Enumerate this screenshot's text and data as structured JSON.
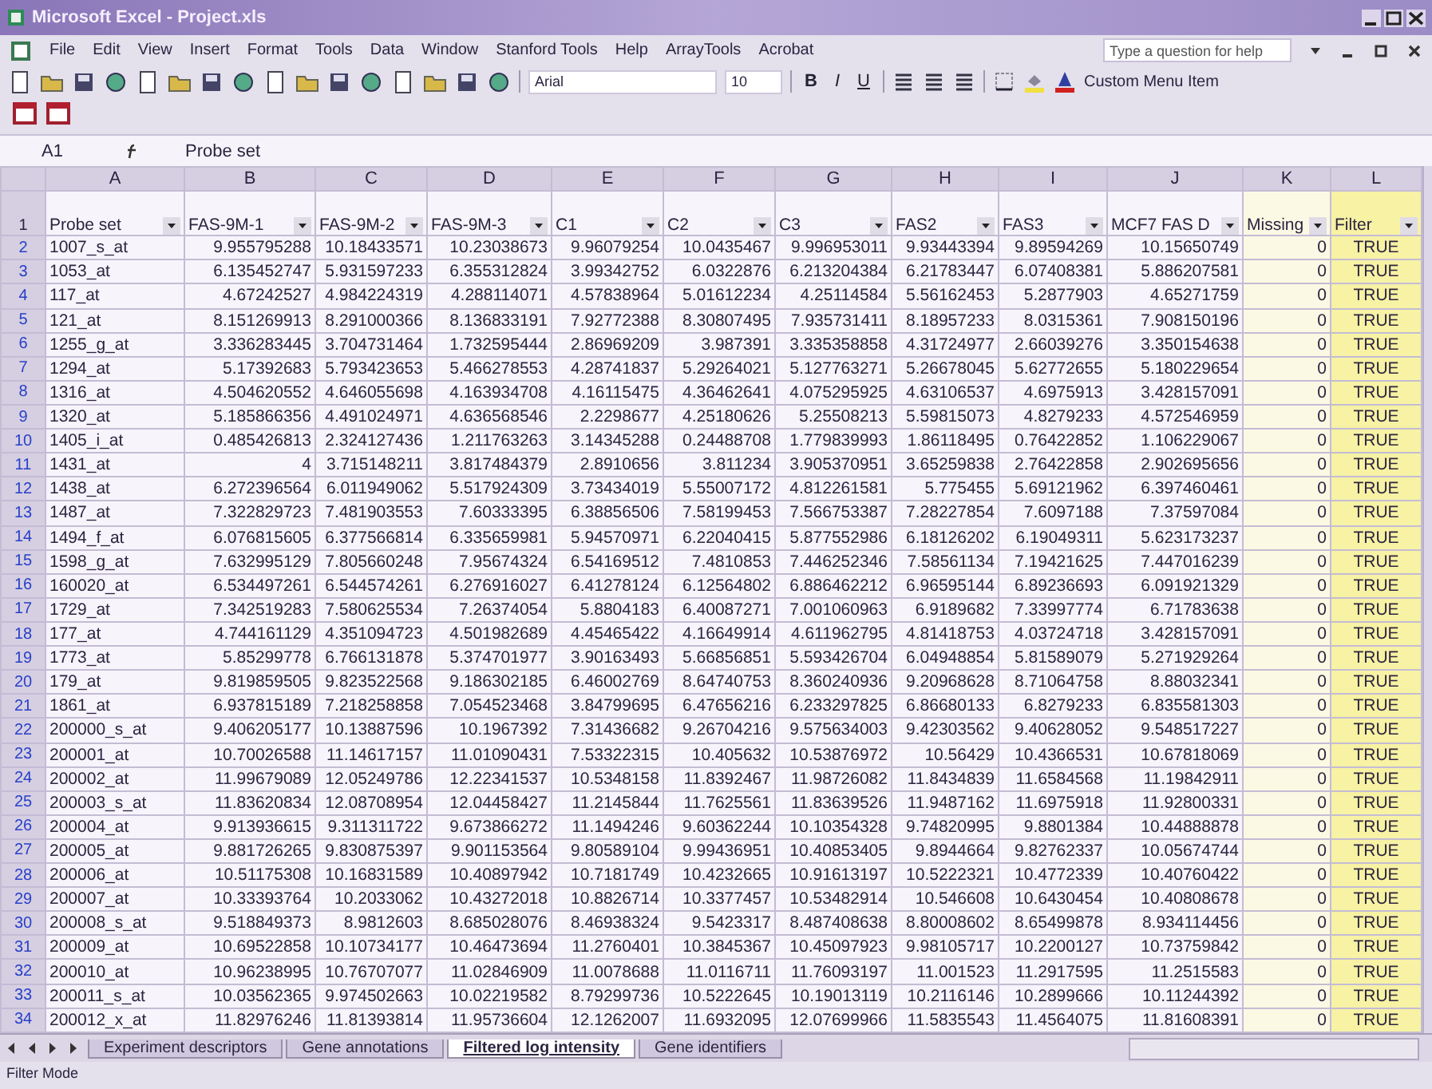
{
  "window": {
    "title": "Microsoft Excel - Project.xls"
  },
  "menu": [
    "File",
    "Edit",
    "View",
    "Insert",
    "Format",
    "Tools",
    "Data",
    "Window",
    "Stanford Tools",
    "Help",
    "ArrayTools",
    "Acrobat"
  ],
  "help_box": {
    "placeholder": "Type a question for help"
  },
  "toolbar": {
    "font": "Arial",
    "size": "10",
    "format_buttons": [
      "B",
      "I",
      "U"
    ],
    "custom_item": "Custom Menu Item"
  },
  "formula_bar": {
    "cell": "A1",
    "content": "Probe set"
  },
  "columns": [
    "A",
    "B",
    "C",
    "D",
    "E",
    "F",
    "G",
    "H",
    "I",
    "J",
    "K",
    "L"
  ],
  "header_row": {
    "n": "1",
    "cells": [
      "Probe set",
      "FAS-9M-1",
      "FAS-9M-2",
      "FAS-9M-3",
      "C1",
      "C2",
      "C3",
      "FAS2",
      "FAS3",
      "MCF7 FAS D",
      "Missing",
      "Filter"
    ]
  },
  "rows": [
    {
      "n": "2",
      "cells": [
        "1007_s_at",
        "9.955795288",
        "10.18433571",
        "10.23038673",
        "9.96079254",
        "10.0435467",
        "9.996953011",
        "9.93443394",
        "9.89594269",
        "10.15650749",
        "0",
        "TRUE"
      ]
    },
    {
      "n": "3",
      "cells": [
        "1053_at",
        "6.135452747",
        "5.931597233",
        "6.355312824",
        "3.99342752",
        "6.0322876",
        "6.213204384",
        "6.21783447",
        "6.07408381",
        "5.886207581",
        "0",
        "TRUE"
      ]
    },
    {
      "n": "4",
      "cells": [
        "117_at",
        "4.67242527",
        "4.984224319",
        "4.288114071",
        "4.57838964",
        "5.01612234",
        "4.25114584",
        "5.56162453",
        "5.2877903",
        "4.65271759",
        "0",
        "TRUE"
      ]
    },
    {
      "n": "5",
      "cells": [
        "121_at",
        "8.151269913",
        "8.291000366",
        "8.136833191",
        "7.92772388",
        "8.30807495",
        "7.935731411",
        "8.18957233",
        "8.0315361",
        "7.908150196",
        "0",
        "TRUE"
      ]
    },
    {
      "n": "6",
      "cells": [
        "1255_g_at",
        "3.336283445",
        "3.704731464",
        "1.732595444",
        "2.86969209",
        "3.987391",
        "3.335358858",
        "4.31724977",
        "2.66039276",
        "3.350154638",
        "0",
        "TRUE"
      ]
    },
    {
      "n": "7",
      "cells": [
        "1294_at",
        "5.17392683",
        "5.793423653",
        "5.466278553",
        "4.28741837",
        "5.29264021",
        "5.127763271",
        "5.26678045",
        "5.62772655",
        "5.180229654",
        "0",
        "TRUE"
      ]
    },
    {
      "n": "8",
      "cells": [
        "1316_at",
        "4.504620552",
        "4.646055698",
        "4.163934708",
        "4.16115475",
        "4.36462641",
        "4.075295925",
        "4.63106537",
        "4.6975913",
        "3.428157091",
        "0",
        "TRUE"
      ]
    },
    {
      "n": "9",
      "cells": [
        "1320_at",
        "5.185866356",
        "4.491024971",
        "4.636568546",
        "2.2298677",
        "4.25180626",
        "5.25508213",
        "5.59815073",
        "4.8279233",
        "4.572546959",
        "0",
        "TRUE"
      ]
    },
    {
      "n": "10",
      "cells": [
        "1405_i_at",
        "0.485426813",
        "2.324127436",
        "1.211763263",
        "3.14345288",
        "0.24488708",
        "1.779839993",
        "1.86118495",
        "0.76422852",
        "1.106229067",
        "0",
        "TRUE"
      ]
    },
    {
      "n": "11",
      "cells": [
        "1431_at",
        "4",
        "3.715148211",
        "3.817484379",
        "2.8910656",
        "3.811234",
        "3.905370951",
        "3.65259838",
        "2.76422858",
        "2.902695656",
        "0",
        "TRUE"
      ]
    },
    {
      "n": "12",
      "cells": [
        "1438_at",
        "6.272396564",
        "6.011949062",
        "5.517924309",
        "3.73434019",
        "5.55007172",
        "4.812261581",
        "5.775455",
        "5.69121962",
        "6.397460461",
        "0",
        "TRUE"
      ]
    },
    {
      "n": "13",
      "cells": [
        "1487_at",
        "7.322829723",
        "7.481903553",
        "7.60333395",
        "6.38856506",
        "7.58199453",
        "7.566753387",
        "7.28227854",
        "7.6097188",
        "7.37597084",
        "0",
        "TRUE"
      ]
    },
    {
      "n": "14",
      "cells": [
        "1494_f_at",
        "6.076815605",
        "6.377566814",
        "6.335659981",
        "5.94570971",
        "6.22040415",
        "5.877552986",
        "6.18126202",
        "6.19049311",
        "5.623173237",
        "0",
        "TRUE"
      ]
    },
    {
      "n": "15",
      "cells": [
        "1598_g_at",
        "7.632995129",
        "7.805660248",
        "7.95674324",
        "6.54169512",
        "7.4810853",
        "7.446252346",
        "7.58561134",
        "7.19421625",
        "7.447016239",
        "0",
        "TRUE"
      ]
    },
    {
      "n": "16",
      "cells": [
        "160020_at",
        "6.534497261",
        "6.544574261",
        "6.276916027",
        "6.41278124",
        "6.12564802",
        "6.886462212",
        "6.96595144",
        "6.89236693",
        "6.091921329",
        "0",
        "TRUE"
      ]
    },
    {
      "n": "17",
      "cells": [
        "1729_at",
        "7.342519283",
        "7.580625534",
        "7.26374054",
        "5.8804183",
        "6.40087271",
        "7.001060963",
        "6.9189682",
        "7.33997774",
        "6.71783638",
        "0",
        "TRUE"
      ]
    },
    {
      "n": "18",
      "cells": [
        "177_at",
        "4.744161129",
        "4.351094723",
        "4.501982689",
        "4.45465422",
        "4.16649914",
        "4.611962795",
        "4.81418753",
        "4.03724718",
        "3.428157091",
        "0",
        "TRUE"
      ]
    },
    {
      "n": "19",
      "cells": [
        "1773_at",
        "5.85299778",
        "6.766131878",
        "5.374701977",
        "3.90163493",
        "5.66856851",
        "5.593426704",
        "6.04948854",
        "5.81589079",
        "5.271929264",
        "0",
        "TRUE"
      ]
    },
    {
      "n": "20",
      "cells": [
        "179_at",
        "9.819859505",
        "9.823522568",
        "9.186302185",
        "6.46002769",
        "8.64740753",
        "8.360240936",
        "9.20968628",
        "8.71064758",
        "8.88032341",
        "0",
        "TRUE"
      ]
    },
    {
      "n": "21",
      "cells": [
        "1861_at",
        "6.937815189",
        "7.218258858",
        "7.054523468",
        "3.84799695",
        "6.47656216",
        "6.233297825",
        "6.86680133",
        "6.8279233",
        "6.835581303",
        "0",
        "TRUE"
      ]
    },
    {
      "n": "22",
      "cells": [
        "200000_s_at",
        "9.406205177",
        "10.13887596",
        "10.1967392",
        "7.31436682",
        "9.26704216",
        "9.575634003",
        "9.42303562",
        "9.40628052",
        "9.548517227",
        "0",
        "TRUE"
      ]
    },
    {
      "n": "23",
      "cells": [
        "200001_at",
        "10.70026588",
        "11.14617157",
        "11.01090431",
        "7.53322315",
        "10.405632",
        "10.53876972",
        "10.56429",
        "10.4366531",
        "10.67818069",
        "0",
        "TRUE"
      ]
    },
    {
      "n": "24",
      "cells": [
        "200002_at",
        "11.99679089",
        "12.05249786",
        "12.22341537",
        "10.5348158",
        "11.8392467",
        "11.98726082",
        "11.8434839",
        "11.6584568",
        "11.19842911",
        "0",
        "TRUE"
      ]
    },
    {
      "n": "25",
      "cells": [
        "200003_s_at",
        "11.83620834",
        "12.08708954",
        "12.04458427",
        "11.2145844",
        "11.7625561",
        "11.83639526",
        "11.9487162",
        "11.6975918",
        "11.92800331",
        "0",
        "TRUE"
      ]
    },
    {
      "n": "26",
      "cells": [
        "200004_at",
        "9.913936615",
        "9.311311722",
        "9.673866272",
        "11.1494246",
        "9.60362244",
        "10.10354328",
        "9.74820995",
        "9.8801384",
        "10.44888878",
        "0",
        "TRUE"
      ]
    },
    {
      "n": "27",
      "cells": [
        "200005_at",
        "9.881726265",
        "9.830875397",
        "9.901153564",
        "9.80589104",
        "9.99436951",
        "10.40853405",
        "9.8944664",
        "9.82762337",
        "10.05674744",
        "0",
        "TRUE"
      ]
    },
    {
      "n": "28",
      "cells": [
        "200006_at",
        "10.51175308",
        "10.16831589",
        "10.40897942",
        "10.7181749",
        "10.4232665",
        "10.91613197",
        "10.5222321",
        "10.4772339",
        "10.40760422",
        "0",
        "TRUE"
      ]
    },
    {
      "n": "29",
      "cells": [
        "200007_at",
        "10.33393764",
        "10.2033062",
        "10.43272018",
        "10.8826714",
        "10.3377457",
        "10.53482914",
        "10.546608",
        "10.6430454",
        "10.40808678",
        "0",
        "TRUE"
      ]
    },
    {
      "n": "30",
      "cells": [
        "200008_s_at",
        "9.518849373",
        "8.9812603",
        "8.685028076",
        "8.46938324",
        "9.5423317",
        "8.487408638",
        "8.80008602",
        "8.65499878",
        "8.934114456",
        "0",
        "TRUE"
      ]
    },
    {
      "n": "31",
      "cells": [
        "200009_at",
        "10.69522858",
        "10.10734177",
        "10.46473694",
        "11.2760401",
        "10.3845367",
        "10.45097923",
        "9.98105717",
        "10.2200127",
        "10.73759842",
        "0",
        "TRUE"
      ]
    },
    {
      "n": "32",
      "cells": [
        "200010_at",
        "10.96238995",
        "10.76707077",
        "11.02846909",
        "11.0078688",
        "11.0116711",
        "11.76093197",
        "11.001523",
        "11.2917595",
        "11.2515583",
        "0",
        "TRUE"
      ]
    },
    {
      "n": "33",
      "cells": [
        "200011_s_at",
        "10.03562365",
        "9.974502663",
        "10.02219582",
        "8.79299736",
        "10.5222645",
        "10.19013119",
        "10.2116146",
        "10.2899666",
        "10.11244392",
        "0",
        "TRUE"
      ]
    },
    {
      "n": "34",
      "cells": [
        "200012_x_at",
        "11.82976246",
        "11.81393814",
        "11.95736604",
        "12.1262007",
        "11.6932095",
        "12.07699966",
        "11.5835543",
        "11.4564075",
        "11.81608391",
        "0",
        "TRUE"
      ]
    }
  ],
  "sheet_tabs": [
    {
      "label": "Experiment descriptors",
      "selected": false
    },
    {
      "label": "Gene annotations",
      "selected": false
    },
    {
      "label": "Filtered log intensity",
      "selected": true
    },
    {
      "label": "Gene identifiers",
      "selected": false
    }
  ],
  "status_bar": "Filter Mode"
}
